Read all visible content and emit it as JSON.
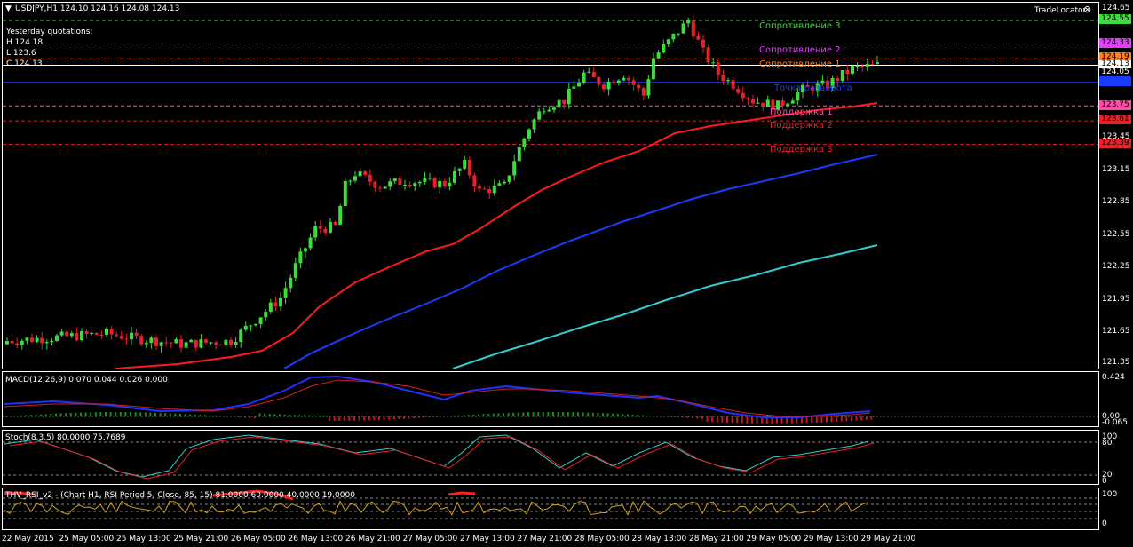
{
  "header": {
    "symbol_line": "USDJPY,H1  124.10 124.16 124.08 124.13",
    "yesterday_title": "Yesterday quotations:",
    "yesterday_high": "H 124.18",
    "yesterday_low": "L 123.6",
    "yesterday_close": "C 124.13",
    "trade_locator": "TradeLocator"
  },
  "levels": {
    "r3": "Сопротивление 3",
    "r2": "Сопротивление 2",
    "r1": "Сопротивление 1",
    "pivot_hidden": "Точка разворота",
    "s1": "Поддержка 1",
    "s2": "Поддержка 2",
    "s3": "Поддержка 3"
  },
  "price_axis": {
    "ticks": [
      "124.65",
      "123.45",
      "123.15",
      "122.85",
      "122.55",
      "122.25",
      "121.95",
      "121.65",
      "121.35"
    ],
    "tags": [
      {
        "text": "124.55",
        "color": "#3ddc3d"
      },
      {
        "text": "124.33",
        "color": "#e040fb"
      },
      {
        "text": "124.19",
        "color": "#ff7f27"
      },
      {
        "text": "124.13",
        "color": "#ffffff"
      },
      {
        "text": "124.05",
        "color": "#000000"
      },
      {
        "text": "123.97",
        "color": "#1a3cff"
      },
      {
        "text": "123.75",
        "color": "#ff4da6"
      },
      {
        "text": "123.61",
        "color": "#e8202a"
      },
      {
        "text": "123.39",
        "color": "#e8202a"
      }
    ]
  },
  "macd": {
    "label": "MACD(12,26,9) 0.070 0.044 0.026 0.000",
    "ticks": [
      "0.424",
      "0.00",
      "-0.065"
    ],
    "zero_label": "0.00"
  },
  "stoch": {
    "label": "Stoch(8,3,5) 80.0000 75.7689",
    "ticks": [
      "100",
      "80",
      "20",
      "0"
    ]
  },
  "rsi": {
    "label": "THV_RSI_v2 - (Chart H1,  RSI Period 5,  Close,  85,  15)  81.0000 60.0000 40.0000 19.0000",
    "ticks": [
      "100",
      "0"
    ]
  },
  "time_axis": [
    "22 May 2015",
    "25 May 05:00",
    "25 May 13:00",
    "25 May 21:00",
    "26 May 05:00",
    "26 May 13:00",
    "26 May 21:00",
    "27 May 05:00",
    "27 May 13:00",
    "27 May 21:00",
    "28 May 05:00",
    "28 May 13:00",
    "28 May 21:00",
    "29 May 05:00",
    "29 May 13:00",
    "29 May 21:00"
  ],
  "colors": {
    "bull": "#3ddc3d",
    "bear": "#e8202a",
    "ma_fast": "#ff1a1a",
    "ma_mid": "#1a3cff",
    "ma_slow": "#33cccc"
  }
}
